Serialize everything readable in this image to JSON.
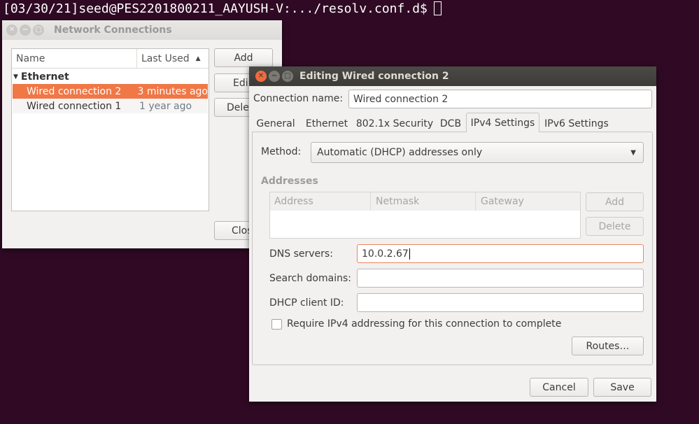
{
  "terminal": {
    "prompt": "[03/30/21]seed@PES2201800211_AAYUSH-V:.../resolv.conf.d$"
  },
  "network_connections": {
    "title": "Network Connections",
    "columns": [
      "Name",
      "Last Used"
    ],
    "group": "Ethernet",
    "connections": [
      {
        "name": "Wired connection 2",
        "last_used": "3 minutes ago"
      },
      {
        "name": "Wired connection 1",
        "last_used": "1 year ago"
      }
    ],
    "buttons": {
      "add": "Add",
      "edit": "Edi",
      "delete": "Dele",
      "close": "Clos"
    }
  },
  "editor": {
    "title": "Editing Wired connection 2",
    "connection_name_label": "Connection name:",
    "connection_name_value": "Wired connection 2",
    "tabs": [
      "General",
      "Ethernet",
      "802.1x Security",
      "DCB",
      "IPv4 Settings",
      "IPv6 Settings"
    ],
    "selected_tab": "IPv4 Settings",
    "method_label": "Method:",
    "method_value": "Automatic (DHCP) addresses only",
    "addresses_label": "Addresses",
    "address_columns": [
      "Address",
      "Netmask",
      "Gateway"
    ],
    "address_add": "Add",
    "address_delete": "Delete",
    "dns_label": "DNS servers:",
    "dns_value": "10.0.2.67",
    "search_domains_label": "Search domains:",
    "search_domains_value": "",
    "dhcp_client_id_label": "DHCP client ID:",
    "dhcp_client_id_value": "",
    "require_ipv4_label": "Require IPv4 addressing for this connection to complete",
    "require_ipv4_checked": false,
    "routes_button": "Routes…",
    "cancel_button": "Cancel",
    "save_button": "Save"
  },
  "colors": {
    "desktop_background": "#300a24",
    "selection_orange": "#f07746",
    "active_titlebar": "#3c3b37",
    "focus_border": "#e9865f"
  }
}
